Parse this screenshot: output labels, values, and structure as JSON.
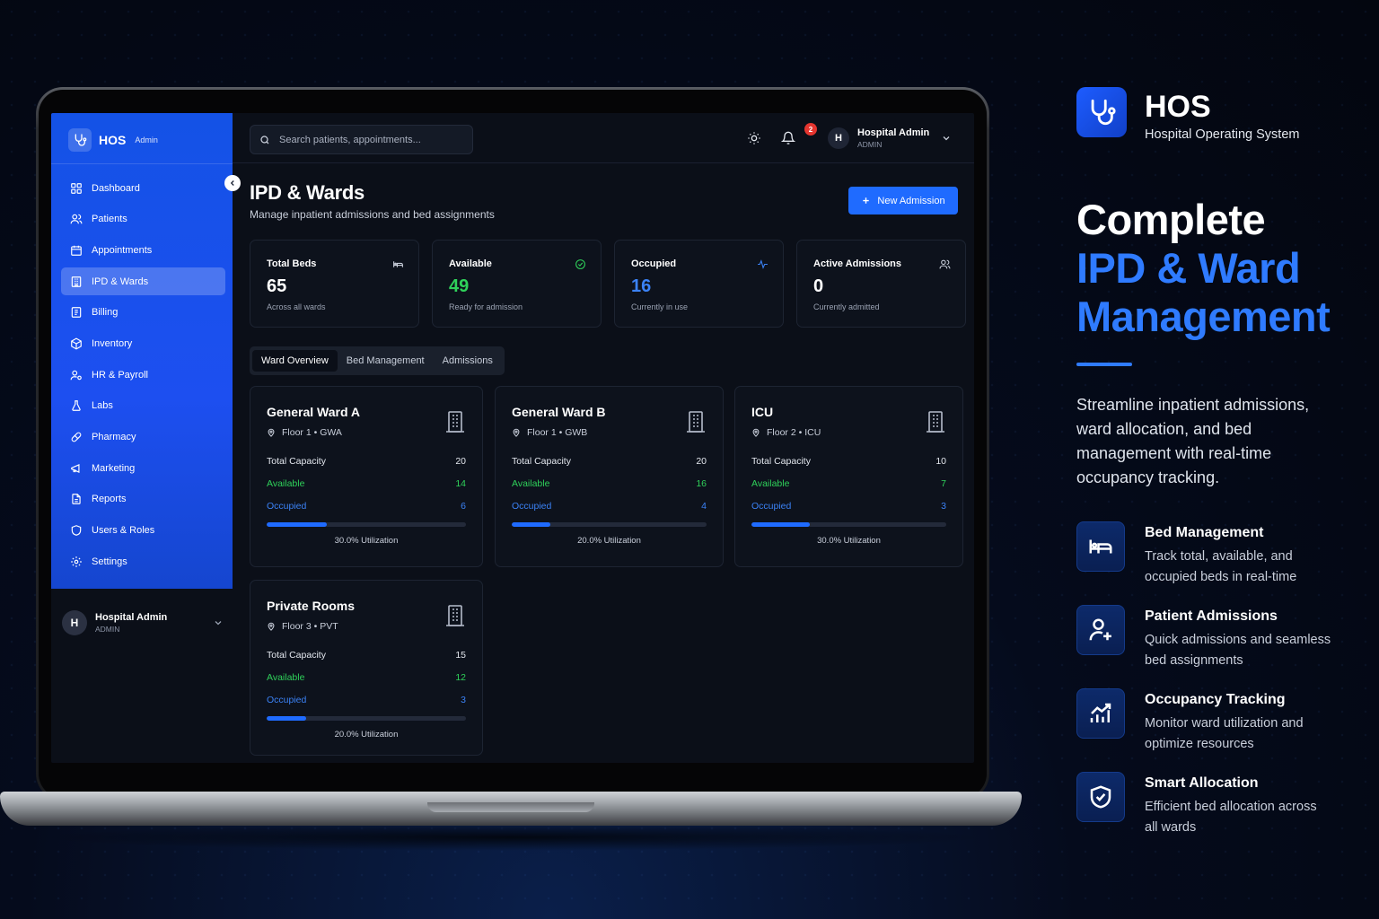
{
  "colors": {
    "accent": "#1f6bff",
    "sidebar": "#1d4ff0",
    "available": "#2fd15a",
    "occupied": "#3b82f6",
    "background": "#0b0f18"
  },
  "brand": {
    "name": "HOS",
    "sub": "Admin"
  },
  "sidebar": {
    "items": [
      {
        "label": "Dashboard",
        "icon": "dashboard-icon"
      },
      {
        "label": "Patients",
        "icon": "users-icon"
      },
      {
        "label": "Appointments",
        "icon": "calendar-icon"
      },
      {
        "label": "IPD & Wards",
        "icon": "building-icon",
        "active": true
      },
      {
        "label": "Billing",
        "icon": "receipt-icon"
      },
      {
        "label": "Inventory",
        "icon": "package-icon"
      },
      {
        "label": "HR & Payroll",
        "icon": "user-cog-icon"
      },
      {
        "label": "Labs",
        "icon": "flask-icon"
      },
      {
        "label": "Pharmacy",
        "icon": "pill-icon"
      },
      {
        "label": "Marketing",
        "icon": "megaphone-icon"
      },
      {
        "label": "Reports",
        "icon": "file-icon"
      },
      {
        "label": "Users & Roles",
        "icon": "shield-icon"
      },
      {
        "label": "Settings",
        "icon": "gear-icon"
      }
    ],
    "user": {
      "initial": "H",
      "name": "Hospital Admin",
      "role": "ADMIN"
    }
  },
  "topbar": {
    "search_placeholder": "Search patients, appointments...",
    "notifications": "2",
    "user": {
      "initial": "H",
      "name": "Hospital Admin",
      "role": "ADMIN"
    }
  },
  "page": {
    "title": "IPD & Wards",
    "subtitle": "Manage inpatient admissions and bed assignments",
    "new_button": "New Admission"
  },
  "stats": [
    {
      "label": "Total Beds",
      "value": "65",
      "hint": "Across all wards",
      "color": "#ffffff",
      "icon": "bed-icon"
    },
    {
      "label": "Available",
      "value": "49",
      "hint": "Ready for admission",
      "color": "#2fd15a",
      "icon": "check-circle-icon"
    },
    {
      "label": "Occupied",
      "value": "16",
      "hint": "Currently in use",
      "color": "#3b82f6",
      "icon": "activity-icon"
    },
    {
      "label": "Active Admissions",
      "value": "0",
      "hint": "Currently admitted",
      "color": "#ffffff",
      "icon": "users-icon"
    }
  ],
  "tabs": [
    "Ward Overview",
    "Bed Management",
    "Admissions"
  ],
  "ward_labels": {
    "capacity": "Total Capacity",
    "available": "Available",
    "occupied": "Occupied"
  },
  "wards": [
    {
      "name": "General Ward A",
      "location": "Floor 1 • GWA",
      "capacity": "20",
      "available": "14",
      "occupied": "6",
      "utilization_pct": 30,
      "utilization_label": "30.0% Utilization"
    },
    {
      "name": "General Ward B",
      "location": "Floor 1 • GWB",
      "capacity": "20",
      "available": "16",
      "occupied": "4",
      "utilization_pct": 20,
      "utilization_label": "20.0% Utilization"
    },
    {
      "name": "ICU",
      "location": "Floor 2 • ICU",
      "capacity": "10",
      "available": "7",
      "occupied": "3",
      "utilization_pct": 30,
      "utilization_label": "30.0% Utilization"
    },
    {
      "name": "Private Rooms",
      "location": "Floor 3 • PVT",
      "capacity": "15",
      "available": "12",
      "occupied": "3",
      "utilization_pct": 20,
      "utilization_label": "20.0% Utilization"
    }
  ],
  "marketing": {
    "name": "HOS",
    "tagline": "Hospital Operating System",
    "headline_1": "Complete",
    "headline_2": "IPD & Ward",
    "headline_3": "Management",
    "description": "Streamline inpatient admissions, ward allocation, and bed management with real-time occupancy tracking.",
    "features": [
      {
        "title": "Bed Management",
        "desc": "Track total, available, and occupied beds in real-time",
        "icon": "bed-icon"
      },
      {
        "title": "Patient Admissions",
        "desc": "Quick admissions and seamless bed assignments",
        "icon": "user-plus-icon"
      },
      {
        "title": "Occupancy Tracking",
        "desc": "Monitor ward utilization and optimize resources",
        "icon": "chart-icon"
      },
      {
        "title": "Smart Allocation",
        "desc": "Efficient bed allocation across all wards",
        "icon": "shield-check-icon"
      }
    ]
  }
}
